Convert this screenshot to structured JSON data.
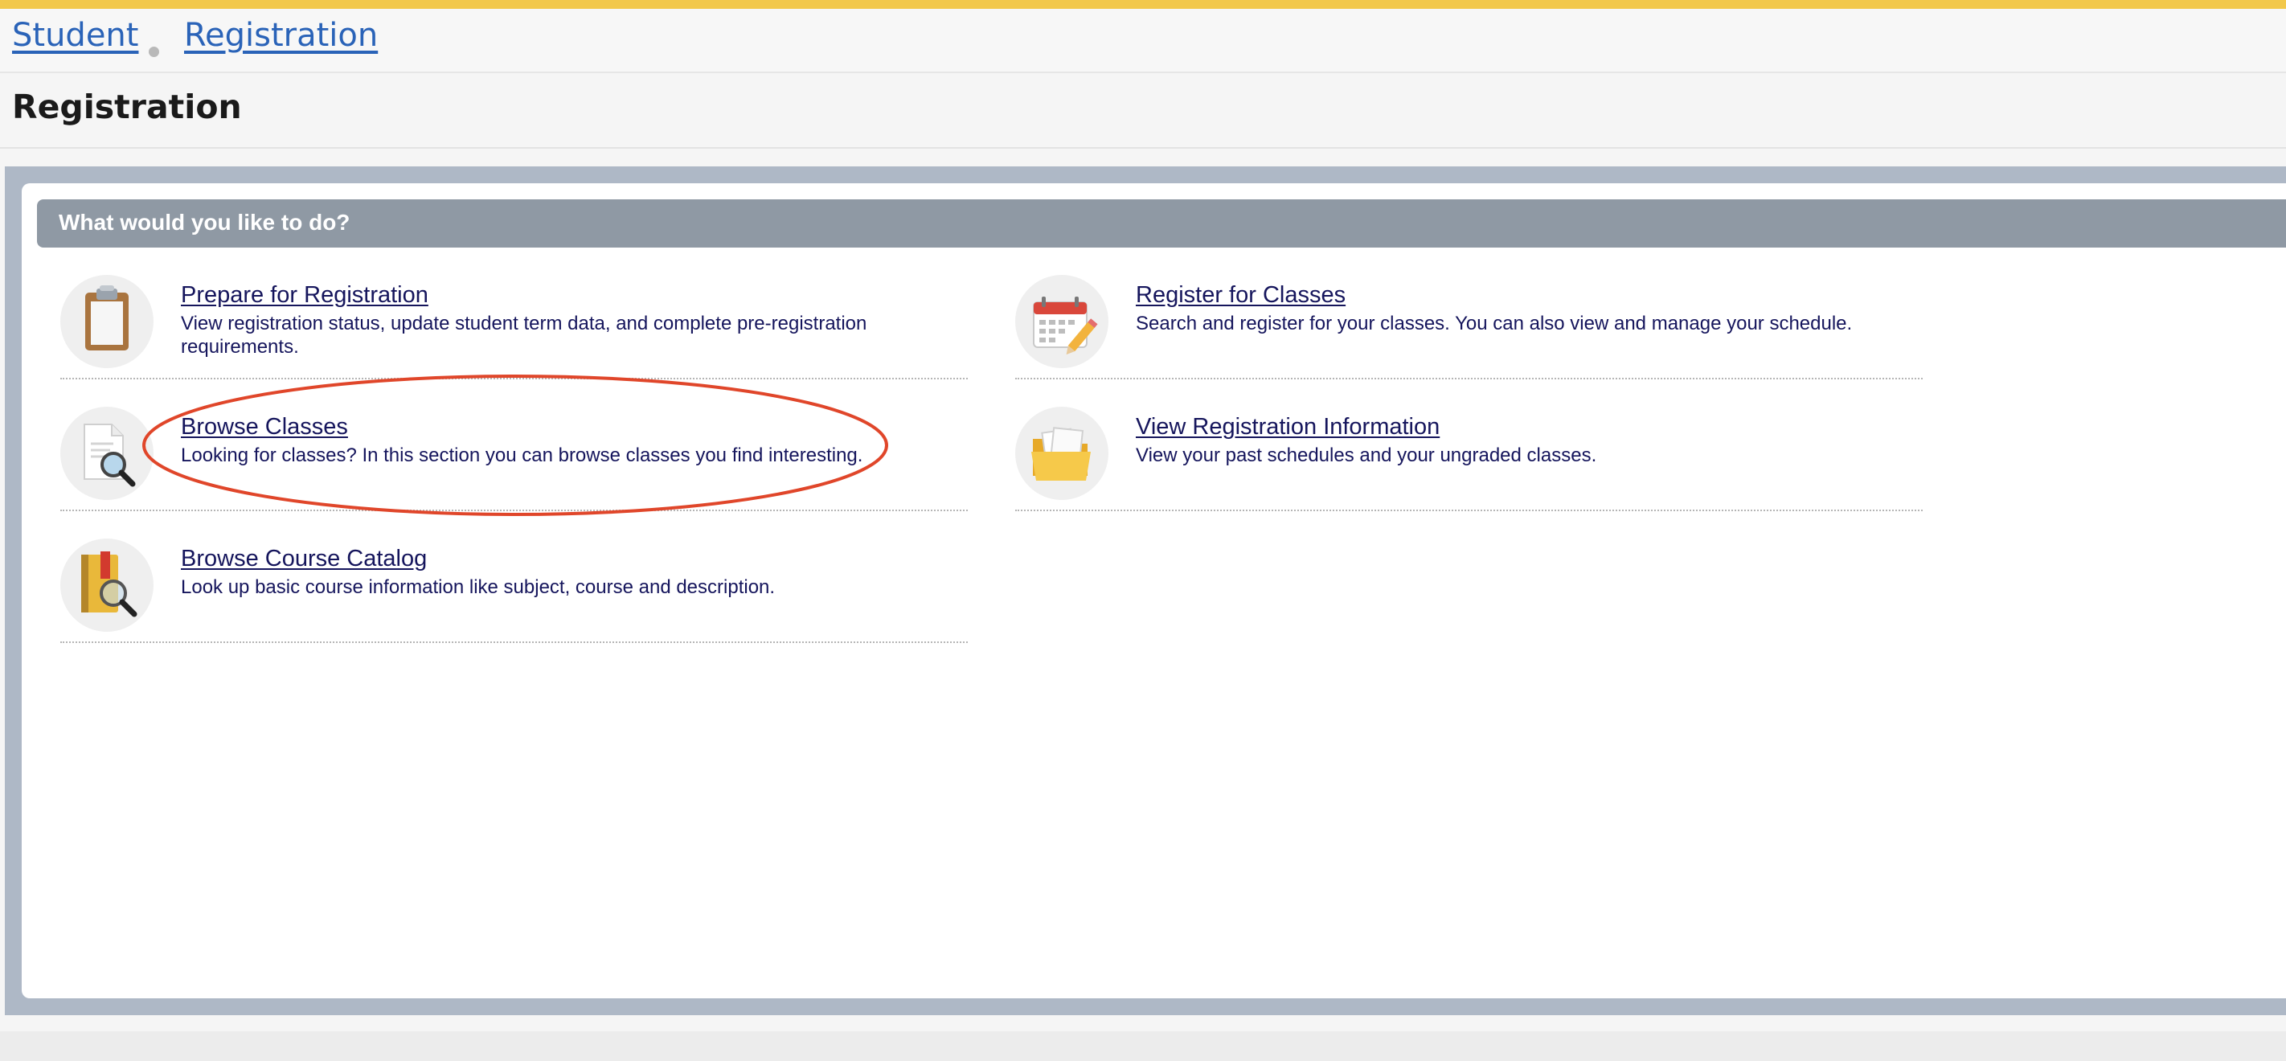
{
  "breadcrumb": {
    "items": [
      {
        "label": "Student"
      },
      {
        "label": "Registration"
      }
    ]
  },
  "page": {
    "title": "Registration"
  },
  "panel": {
    "header": "What would you like to do?"
  },
  "actions": [
    {
      "title": "Prepare for Registration",
      "description": "View registration status, update student term data, and complete pre-registration requirements.",
      "icon": "clipboard-icon"
    },
    {
      "title": "Register for Classes",
      "description": "Search and register for your classes. You can also view and manage your schedule.",
      "icon": "calendar-icon"
    },
    {
      "title": "Browse Classes",
      "description": "Looking for classes? In this section you can browse classes you find interesting.",
      "icon": "document-search-icon"
    },
    {
      "title": "View Registration Information",
      "description": "View your past schedules and your ungraded classes.",
      "icon": "folder-icon"
    },
    {
      "title": "Browse Course Catalog",
      "description": "Look up basic course information like subject, course and description.",
      "icon": "book-search-icon"
    }
  ],
  "annotation": {
    "shape": "ellipse",
    "color": "#e0462a",
    "target": "Browse Classes"
  },
  "colors": {
    "accent_stripe": "#f2c84b",
    "link": "#2a63b8",
    "action_text": "#15155c",
    "panel_header": "#8f99a4"
  }
}
